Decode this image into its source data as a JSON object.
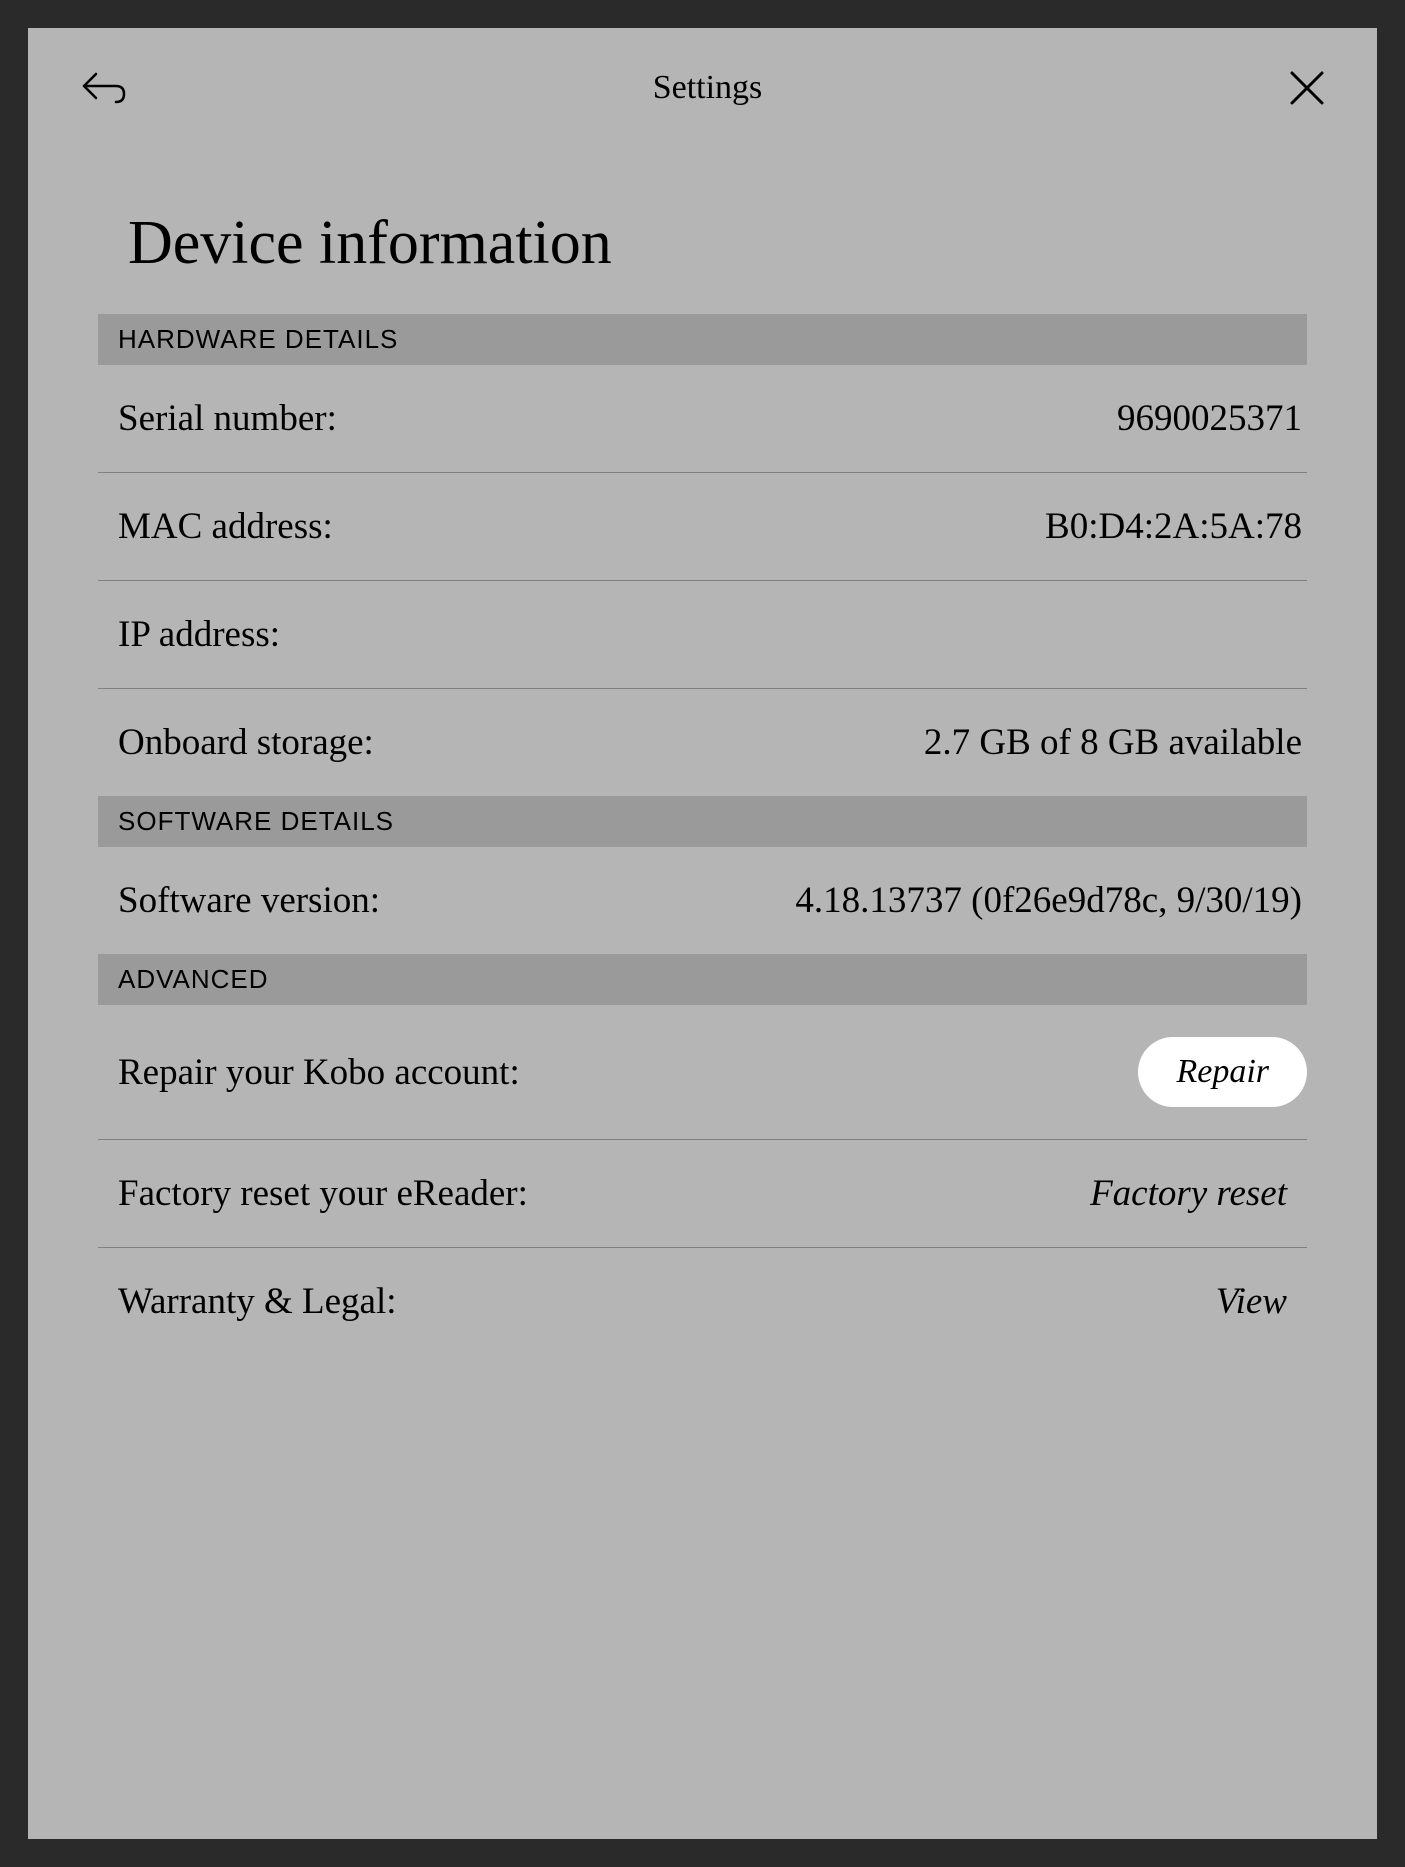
{
  "header": {
    "title": "Settings"
  },
  "page": {
    "title": "Device information"
  },
  "sections": {
    "hardware": {
      "header": "HARDWARE DETAILS",
      "serial_label": "Serial number:",
      "serial_value": "9690025371",
      "mac_label": "MAC address:",
      "mac_value": "B0:D4:2A:5A:78",
      "ip_label": "IP address:",
      "ip_value": "",
      "storage_label": "Onboard storage:",
      "storage_value": "2.7 GB of 8 GB available"
    },
    "software": {
      "header": "SOFTWARE DETAILS",
      "version_label": "Software version:",
      "version_value": "4.18.13737 (0f26e9d78c, 9/30/19)"
    },
    "advanced": {
      "header": "ADVANCED",
      "repair_label": "Repair your Kobo account:",
      "repair_action": "Repair",
      "reset_label": "Factory reset your eReader:",
      "reset_action": "Factory reset",
      "warranty_label": "Warranty & Legal:",
      "warranty_action": "View"
    }
  }
}
